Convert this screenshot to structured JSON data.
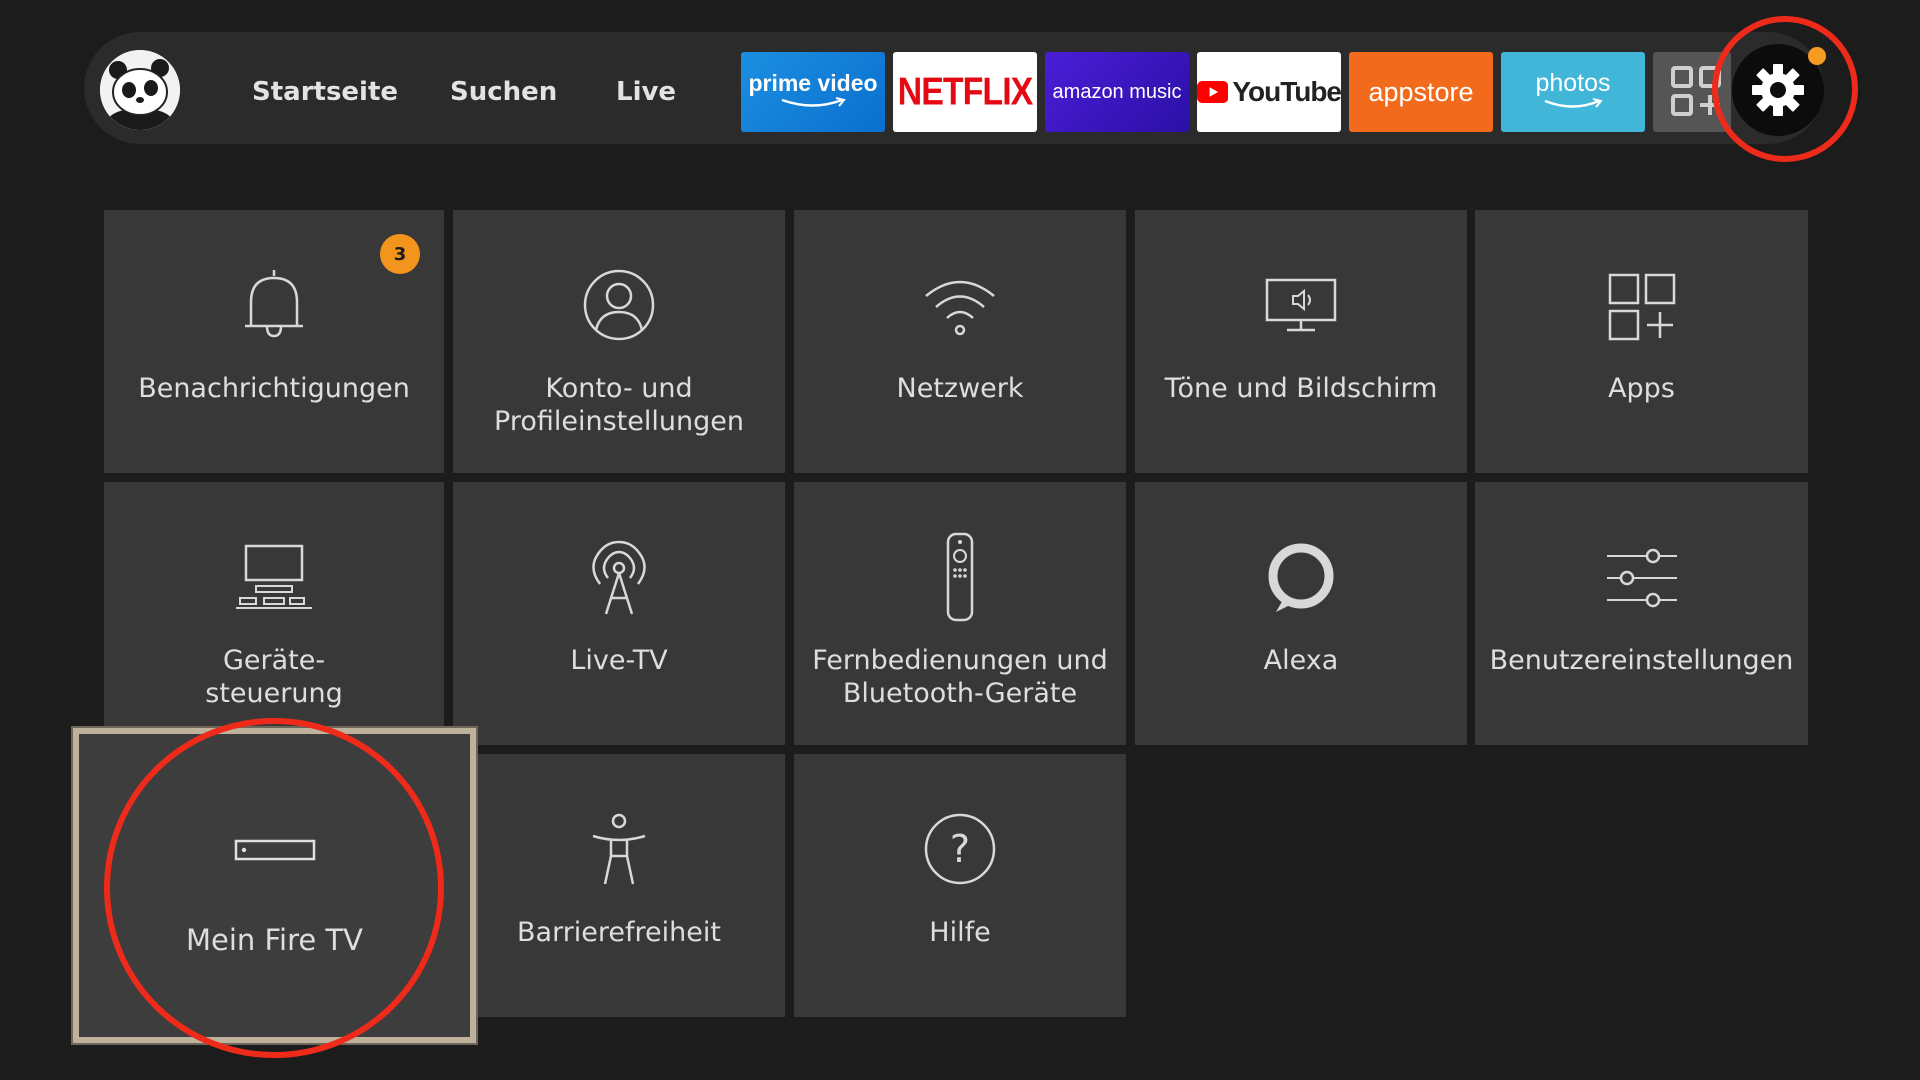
{
  "nav": {
    "links": [
      "Startseite",
      "Suchen",
      "Live"
    ]
  },
  "apps": {
    "prime_video": "prime video",
    "netflix": "NETFLIX",
    "amazon_music": "amazon music",
    "youtube": "YouTube",
    "appstore": "appstore",
    "photos": "photos"
  },
  "settings": {
    "cards": [
      {
        "label": "Benachrichtigungen",
        "icon": "bell-icon",
        "badge": "3"
      },
      {
        "label": "Konto- und\nProfileinstellungen",
        "icon": "account-icon"
      },
      {
        "label": "Netzwerk",
        "icon": "wifi-icon"
      },
      {
        "label": "Töne und Bildschirm",
        "icon": "display-sound-icon"
      },
      {
        "label": "Apps",
        "icon": "apps-icon"
      },
      {
        "label": "Geräte-\nsteuerung",
        "icon": "device-control-icon"
      },
      {
        "label": "Live-TV",
        "icon": "antenna-icon"
      },
      {
        "label": "Fernbedienungen und\nBluetooth-Geräte",
        "icon": "remote-icon"
      },
      {
        "label": "Alexa",
        "icon": "alexa-icon"
      },
      {
        "label": "Benutzereinstellungen",
        "icon": "sliders-icon"
      },
      {
        "label": "Mein Fire TV",
        "icon": "fire-tv-stick-icon",
        "selected": true
      },
      {
        "label": "Barrierefreiheit",
        "icon": "accessibility-icon"
      },
      {
        "label": "Hilfe",
        "icon": "help-icon"
      }
    ]
  },
  "colors": {
    "accent_ring": "#ee2a1b",
    "badge": "#f3941c",
    "card": "#383838",
    "background": "#1c1c1c"
  }
}
